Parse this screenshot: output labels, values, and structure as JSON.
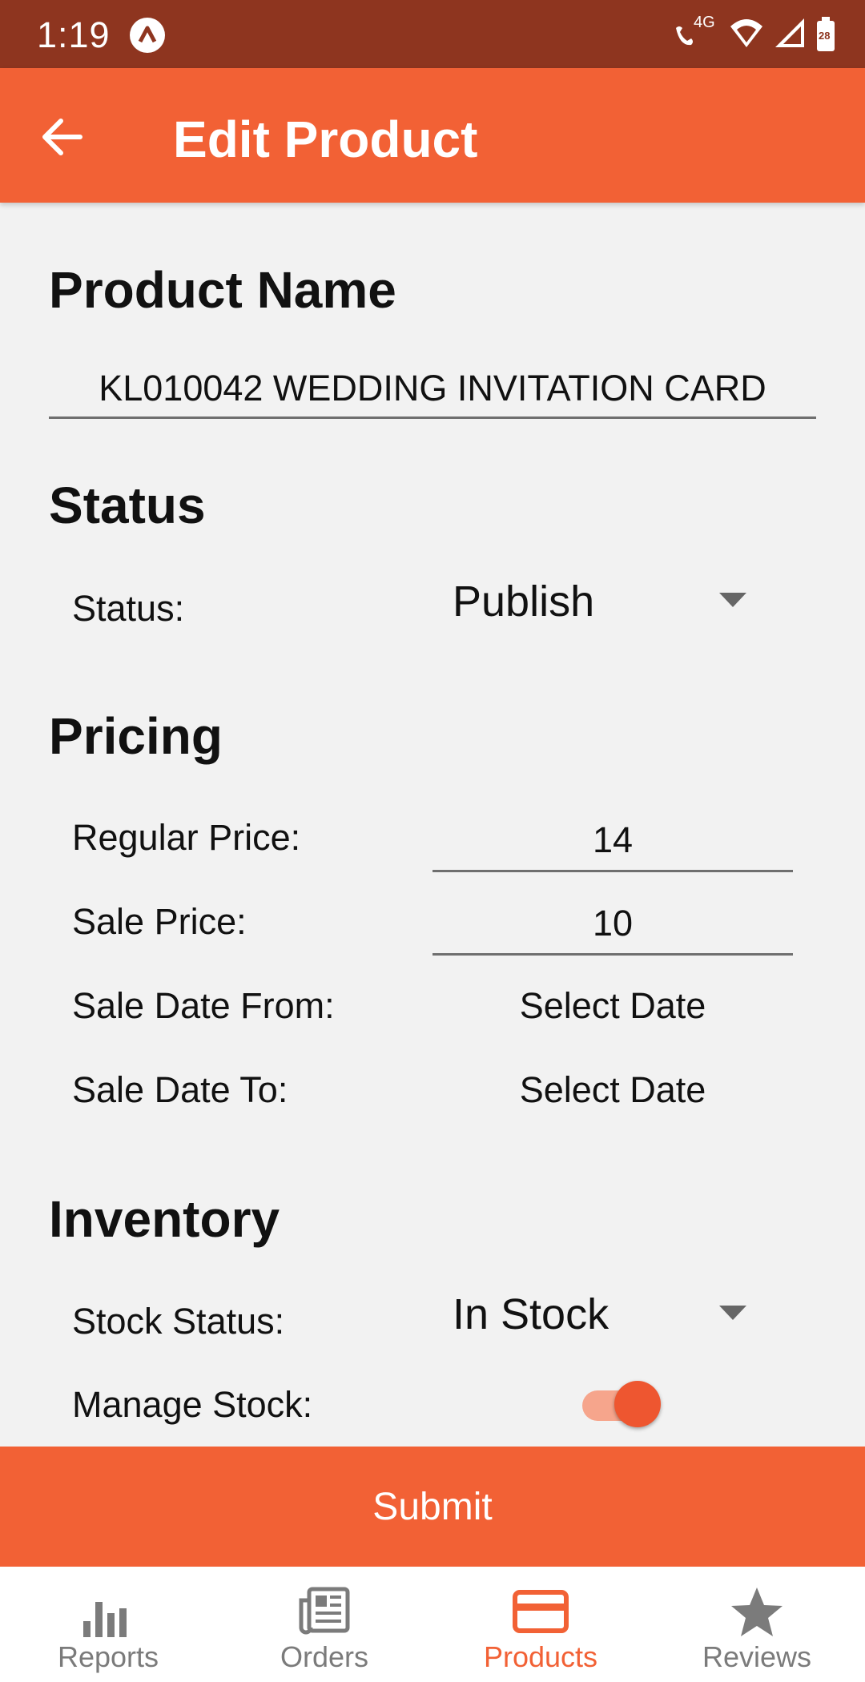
{
  "status_bar": {
    "time": "1:19",
    "network": "4G",
    "battery": "28"
  },
  "app_bar": {
    "title": "Edit Product"
  },
  "product_name": {
    "heading": "Product Name",
    "value": "KL010042 WEDDING INVITATION CARD"
  },
  "status": {
    "heading": "Status",
    "label": "Status:",
    "value": "Publish"
  },
  "pricing": {
    "heading": "Pricing",
    "regular_price_label": "Regular Price:",
    "regular_price": "14",
    "sale_price_label": "Sale Price:",
    "sale_price": "10",
    "sale_date_from_label": "Sale Date From:",
    "sale_date_from": "Select Date",
    "sale_date_to_label": "Sale Date To:",
    "sale_date_to": "Select Date"
  },
  "inventory": {
    "heading": "Inventory",
    "stock_status_label": "Stock Status:",
    "stock_status": "In Stock",
    "manage_stock_label": "Manage Stock:",
    "manage_stock": true
  },
  "submit_label": "Submit",
  "bottom_nav": {
    "items": [
      {
        "label": "Reports",
        "icon": "bar-chart-icon"
      },
      {
        "label": "Orders",
        "icon": "newspaper-icon"
      },
      {
        "label": "Products",
        "icon": "card-icon",
        "active": true
      },
      {
        "label": "Reviews",
        "icon": "star-icon"
      }
    ]
  },
  "colors": {
    "accent": "#f26135",
    "status_bar": "#8e351f",
    "inactive": "#7b7b7b"
  }
}
